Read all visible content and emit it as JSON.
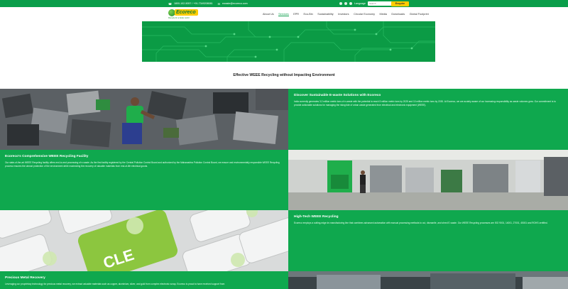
{
  "topbar": {
    "phone": "1800-102-5057 / +91-7349208081",
    "email": "ewaste@ecoreco.com",
    "language": "Language",
    "search_placeholder": "Search",
    "enquire_label": "Enquire"
  },
  "header": {
    "logo_text": "Ecoreco",
    "logo_tagline": "Recycle for a better world",
    "nav": [
      "About Us",
      "Services",
      "EPR",
      "Eco-Bin",
      "Sustainability",
      "Investors",
      "Circular Economy",
      "Media",
      "Downloads",
      "Global Footprint"
    ],
    "active_nav": "Services"
  },
  "page": {
    "heading": "Effective WEEE Recycling without Impacting Environment"
  },
  "sections": {
    "s1": {
      "title": "Discover Sustainable E-waste Solutions with Ecoreco",
      "body": "India currently generates 3.2 million metric tons of e-waste with the potential to reach 5 million metric tons by 2025 and 10 million metric tons by 2030. At Ecoreco, we are acutely aware of our increasing responsibility as waste volumes grow. Our commitment is to provide actionable solutions for managing the rising tide of urban waste generated from electrical and electronic equipment (WEEE)."
    },
    "s2": {
      "title": "Ecoreco's Comprehensive WEEE Recycling Facility",
      "body": "Our state-of-the-art WEEE Recycling facility offers end-to-end processing of e-waste. As the first facility registered by the Central Pollution Control Board and authorized by the Maharashtra Pollution Control Board, we ensure and environmentally responsible WEEE Recycling process ensures the utmost protection of the environment while maximizing the recovery of valuable materials from end-of-life electrical goods."
    },
    "s3": {
      "title": "High-Tech WEEE Recycling",
      "body": "Ecoreco employs a cutting-edge de-manufacturing line that combines advanced automation with manual processing methods to cut, dismantle, and shred E-waste. Our WEEE Recycling processes are ISO 9001, 14001, 27001, 45001 and ROHS certified."
    },
    "s4": {
      "title": "Precious Metal Recovery",
      "body": "Leveraging our proprietary technology for precious metal recovery, we extract valuable materials such as copper, aluminium, silver, and gold from complex electronic scrap. Ecoreco is proud to have received support from"
    }
  },
  "colors": {
    "brand_green": "#0fa84e",
    "topbar_green": "#0a9e4a",
    "accent_yellow": "#ffcc00"
  },
  "icons": [
    "phone-icon",
    "mail-icon",
    "facebook-icon",
    "twitter-icon",
    "linkedin-icon",
    "search-icon",
    "recycle-icon"
  ],
  "images": {
    "recycle_key_text": "CLE"
  }
}
